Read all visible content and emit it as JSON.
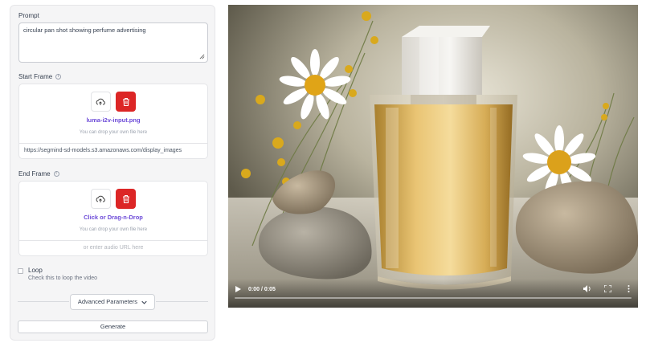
{
  "prompt": {
    "label": "Prompt",
    "value": "circular pan shot showing perfume advertising"
  },
  "start_frame": {
    "label": "Start Frame",
    "file_name": "luma-i2v-input.png",
    "hint": "You can drop your own file here",
    "url_value": "https://segmind-sd-models.s3.amazonaws.com/display_images"
  },
  "end_frame": {
    "label": "End Frame",
    "file_name": "Click or Drag-n-Drop",
    "hint": "You can drop your own file here",
    "url_placeholder": "or enter audio URL here"
  },
  "loop": {
    "label": "Loop",
    "description": "Check this to loop the video",
    "checked": false
  },
  "advanced_label": "Advanced Parameters",
  "generate_label": "Generate",
  "video": {
    "time": "0:00 / 0:05",
    "progress": 0
  },
  "icons": [
    "info-icon",
    "resize-handle-icon",
    "upload-icon",
    "trash-icon",
    "play-icon",
    "volume-icon",
    "fullscreen-icon",
    "more-vertical-icon",
    "chevron-down-icon"
  ],
  "colors": {
    "accent": "#6d4bd8",
    "delete": "#dc2626"
  }
}
